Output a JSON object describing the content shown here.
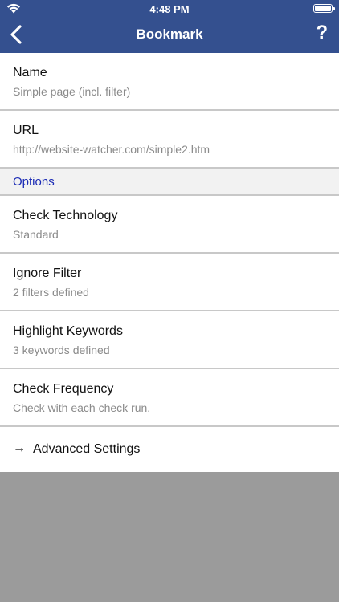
{
  "status": {
    "time": "4:48 PM"
  },
  "nav": {
    "title": "Bookmark",
    "help": "?"
  },
  "fields": {
    "name": {
      "label": "Name",
      "value": "Simple page (incl. filter)"
    },
    "url": {
      "label": "URL",
      "value": "http://website-watcher.com/simple2.htm"
    }
  },
  "options": {
    "header": "Options",
    "items": [
      {
        "label": "Check Technology",
        "value": "Standard"
      },
      {
        "label": "Ignore Filter",
        "value": "2 filters defined"
      },
      {
        "label": "Highlight Keywords",
        "value": "3 keywords defined"
      },
      {
        "label": "Check Frequency",
        "value": "Check with each check run."
      }
    ]
  },
  "advanced": {
    "arrow": "→",
    "label": "Advanced Settings"
  }
}
